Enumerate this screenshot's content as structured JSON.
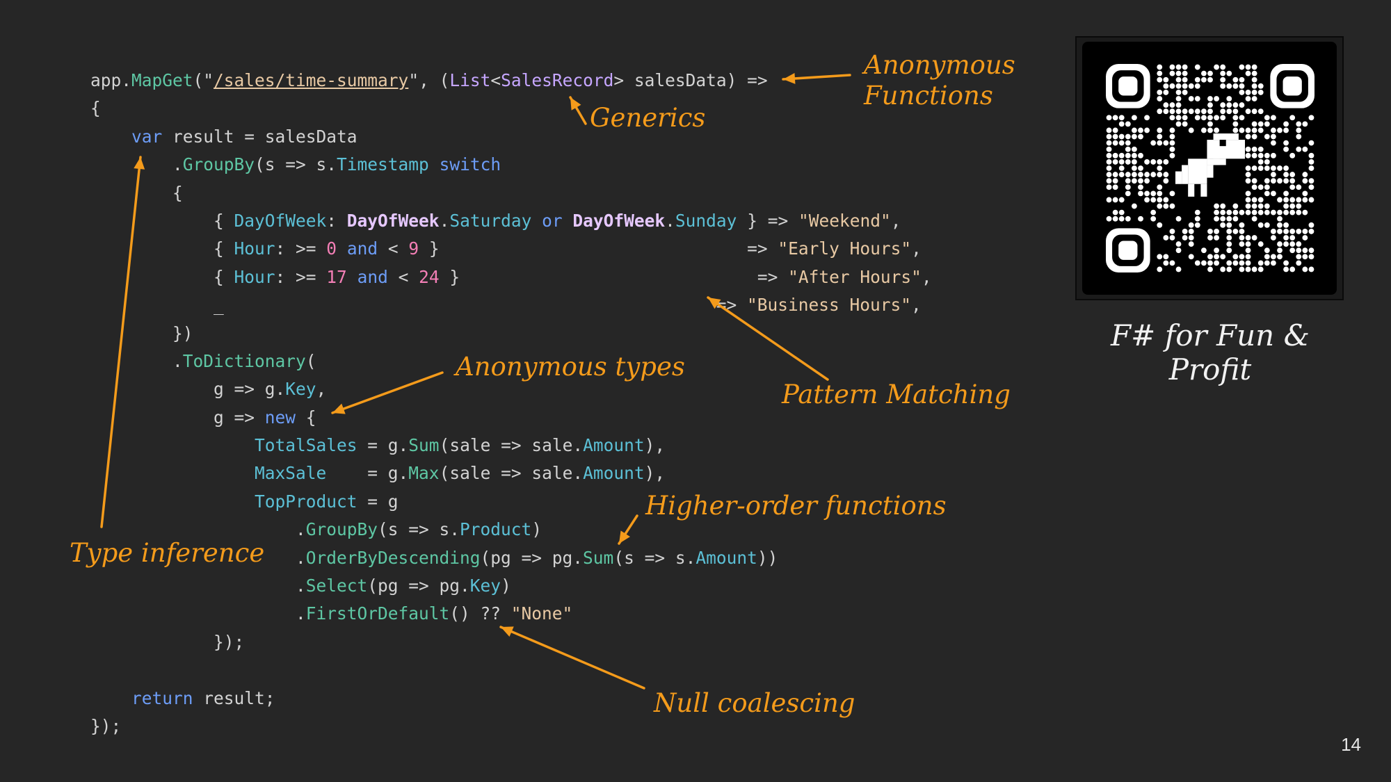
{
  "code_lines": [
    [
      [
        "app.",
        "plain"
      ],
      [
        "MapGet",
        "method"
      ],
      [
        "(\"",
        "plain"
      ],
      [
        "/sales/time-summary",
        "url"
      ],
      [
        "\", (",
        "plain"
      ],
      [
        "List",
        "type"
      ],
      [
        "<",
        "plain"
      ],
      [
        "SalesRecord",
        "type"
      ],
      [
        "> salesData) =>",
        "plain"
      ]
    ],
    [
      [
        "{",
        "plain"
      ]
    ],
    [
      [
        "    ",
        "plain"
      ],
      [
        "var",
        "kw"
      ],
      [
        " result = salesData",
        "plain"
      ]
    ],
    [
      [
        "        .",
        "plain"
      ],
      [
        "GroupBy",
        "method"
      ],
      [
        "(s => s.",
        "plain"
      ],
      [
        "Timestamp",
        "prop"
      ],
      [
        " ",
        "plain"
      ],
      [
        "switch",
        "kw"
      ]
    ],
    [
      [
        "        {",
        "plain"
      ]
    ],
    [
      [
        "            { ",
        "plain"
      ],
      [
        "DayOfWeek",
        "prop"
      ],
      [
        ": ",
        "plain"
      ],
      [
        "DayOfWeek",
        "typeb"
      ],
      [
        ".",
        "plain"
      ],
      [
        "Saturday",
        "prop"
      ],
      [
        " ",
        "plain"
      ],
      [
        "or",
        "kw"
      ],
      [
        " ",
        "plain"
      ],
      [
        "DayOfWeek",
        "typeb"
      ],
      [
        ".",
        "plain"
      ],
      [
        "Sunday",
        "prop"
      ],
      [
        " } => ",
        "plain"
      ],
      [
        "\"Weekend\"",
        "str"
      ],
      [
        ",",
        "plain"
      ]
    ],
    [
      [
        "            { ",
        "plain"
      ],
      [
        "Hour",
        "prop"
      ],
      [
        ": >= ",
        "plain"
      ],
      [
        "0",
        "num"
      ],
      [
        " ",
        "plain"
      ],
      [
        "and",
        "kw"
      ],
      [
        " < ",
        "plain"
      ],
      [
        "9",
        "num"
      ],
      [
        " }                              => ",
        "plain"
      ],
      [
        "\"Early Hours\"",
        "str"
      ],
      [
        ",",
        "plain"
      ]
    ],
    [
      [
        "            { ",
        "plain"
      ],
      [
        "Hour",
        "prop"
      ],
      [
        ": >= ",
        "plain"
      ],
      [
        "17",
        "num"
      ],
      [
        " ",
        "plain"
      ],
      [
        "and",
        "kw"
      ],
      [
        " < ",
        "plain"
      ],
      [
        "24",
        "num"
      ],
      [
        " }                             => ",
        "plain"
      ],
      [
        "\"After Hours\"",
        "str"
      ],
      [
        ",",
        "plain"
      ]
    ],
    [
      [
        "            _                                                => ",
        "plain"
      ],
      [
        "\"Business Hours\"",
        "str"
      ],
      [
        ",",
        "plain"
      ]
    ],
    [
      [
        "        })",
        "plain"
      ]
    ],
    [
      [
        "        .",
        "plain"
      ],
      [
        "ToDictionary",
        "method"
      ],
      [
        "(",
        "plain"
      ]
    ],
    [
      [
        "            g => g.",
        "plain"
      ],
      [
        "Key",
        "prop"
      ],
      [
        ",",
        "plain"
      ]
    ],
    [
      [
        "            g => ",
        "plain"
      ],
      [
        "new",
        "kw"
      ],
      [
        " {",
        "plain"
      ]
    ],
    [
      [
        "                ",
        "plain"
      ],
      [
        "TotalSales",
        "prop"
      ],
      [
        " = g.",
        "plain"
      ],
      [
        "Sum",
        "method"
      ],
      [
        "(sale => sale.",
        "plain"
      ],
      [
        "Amount",
        "prop"
      ],
      [
        "),",
        "plain"
      ]
    ],
    [
      [
        "                ",
        "plain"
      ],
      [
        "MaxSale",
        "prop"
      ],
      [
        "    = g.",
        "plain"
      ],
      [
        "Max",
        "method"
      ],
      [
        "(sale => sale.",
        "plain"
      ],
      [
        "Amount",
        "prop"
      ],
      [
        "),",
        "plain"
      ]
    ],
    [
      [
        "                ",
        "plain"
      ],
      [
        "TopProduct",
        "prop"
      ],
      [
        " = g",
        "plain"
      ]
    ],
    [
      [
        "                    .",
        "plain"
      ],
      [
        "GroupBy",
        "method"
      ],
      [
        "(s => s.",
        "plain"
      ],
      [
        "Product",
        "prop"
      ],
      [
        ")",
        "plain"
      ]
    ],
    [
      [
        "                    .",
        "plain"
      ],
      [
        "OrderByDescending",
        "method"
      ],
      [
        "(pg => pg.",
        "plain"
      ],
      [
        "Sum",
        "method"
      ],
      [
        "(s => s.",
        "plain"
      ],
      [
        "Amount",
        "prop"
      ],
      [
        "))",
        "plain"
      ]
    ],
    [
      [
        "                    .",
        "plain"
      ],
      [
        "Select",
        "method"
      ],
      [
        "(pg => pg.",
        "plain"
      ],
      [
        "Key",
        "prop"
      ],
      [
        ")",
        "plain"
      ]
    ],
    [
      [
        "                    .",
        "plain"
      ],
      [
        "FirstOrDefault",
        "method"
      ],
      [
        "() ?? ",
        "plain"
      ],
      [
        "\"None\"",
        "str"
      ]
    ],
    [
      [
        "            });",
        "plain"
      ]
    ],
    [
      [
        "",
        "plain"
      ]
    ],
    [
      [
        "    ",
        "plain"
      ],
      [
        "return",
        "kw"
      ],
      [
        " result;",
        "plain"
      ]
    ],
    [
      [
        "});",
        "plain"
      ]
    ]
  ],
  "annotations": {
    "anonymous_functions": "Anonymous\nFunctions",
    "generics": "Generics",
    "anonymous_types": "Anonymous types",
    "pattern_matching": "Pattern Matching",
    "higher_order": "Higher-order functions",
    "type_inference": "Type inference",
    "null_coalescing": "Null coalescing"
  },
  "tagline": "F# for Fun & Profit",
  "page_number": "14",
  "colors": {
    "background": "#262626",
    "annotation": "#f49b1b",
    "method": "#5ec7a4",
    "property": "#5cc0d6",
    "type": "#c6a6ff",
    "keyword": "#6d9df7",
    "string": "#e8c9a4",
    "number": "#f47fb6"
  },
  "qr_icon": "dinosaur-icon"
}
